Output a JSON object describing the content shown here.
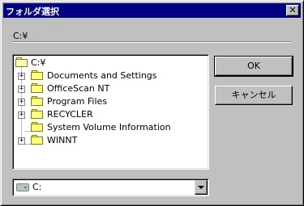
{
  "window": {
    "title": "フォルダ選択",
    "close_glyph": "✕"
  },
  "current_path": "C:¥",
  "tree": {
    "root": {
      "label": "C:¥",
      "icon": "folder-open-icon"
    },
    "items": [
      {
        "label": "Documents and Settings",
        "expandable": true
      },
      {
        "label": "OfficeScan NT",
        "expandable": true
      },
      {
        "label": "Program Files",
        "expandable": true
      },
      {
        "label": "RECYCLER",
        "expandable": true
      },
      {
        "label": "System Volume Information",
        "expandable": false
      },
      {
        "label": "WINNT",
        "expandable": true
      }
    ]
  },
  "buttons": {
    "ok_label": "OK",
    "cancel_label": "キャンセル"
  },
  "drive_select": {
    "value": "C:",
    "icon": "drive-icon"
  },
  "colors": {
    "titlebar": "#000080",
    "face": "#c0c0c0",
    "folder": "#ffff80"
  }
}
